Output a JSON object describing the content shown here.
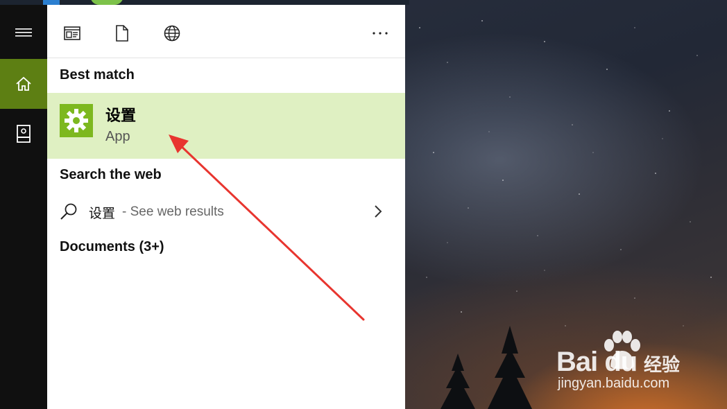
{
  "panel": {
    "toolbar": {
      "icons": [
        "apps-filter-icon",
        "documents-filter-icon",
        "web-filter-icon",
        "more-options-icon"
      ]
    },
    "best_match": {
      "heading": "Best match",
      "item": {
        "name": "设置",
        "type": "App",
        "icon": "gear-icon",
        "accent": "#7db81f",
        "highlight": "#dff0c2"
      }
    },
    "web": {
      "heading": "Search the web",
      "result": {
        "term": "设置",
        "suffix": " - See web results"
      }
    },
    "documents": {
      "heading": "Documents (3+)"
    }
  },
  "rail": {
    "items": [
      "hamburger-menu-icon",
      "home-icon",
      "notebook-icon"
    ],
    "active_color": "#5d7f13"
  },
  "watermark": {
    "brand": "Bai du",
    "suffix": "经验",
    "url": "jingyan.baidu.com"
  },
  "annotation": {
    "arrow_color": "#e8352f"
  }
}
